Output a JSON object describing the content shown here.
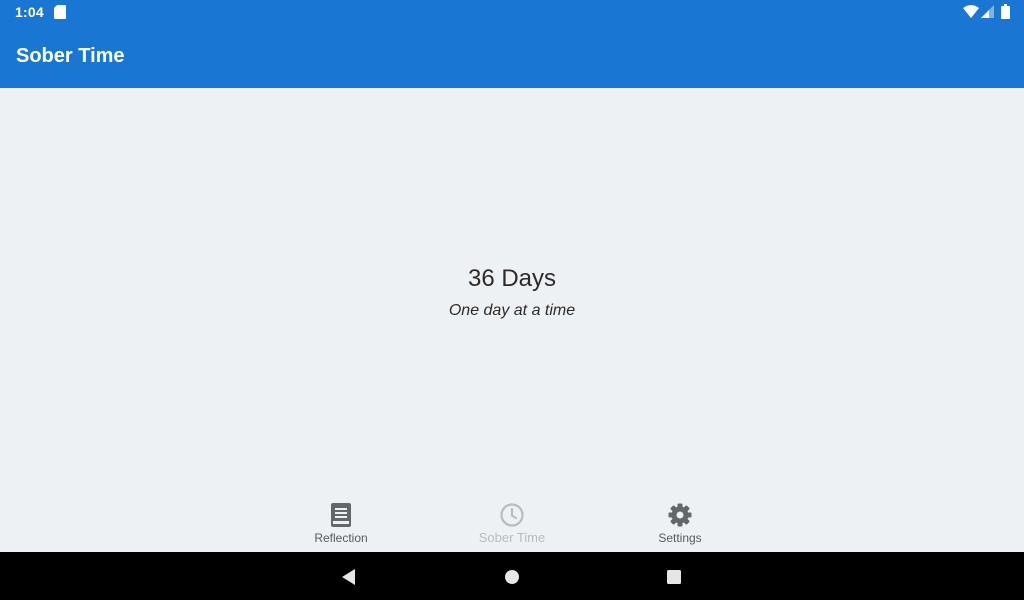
{
  "status_bar": {
    "time": "1:04",
    "icons": [
      "sd-card-icon",
      "wifi-icon",
      "signal-icon",
      "battery-icon"
    ]
  },
  "app_bar": {
    "title": "Sober Time",
    "color": "#1976d2"
  },
  "main": {
    "days_count": "36 Days",
    "tagline": "One day at a time"
  },
  "bottom_nav": {
    "items": [
      {
        "label": "Reflection",
        "icon": "book-icon",
        "active": false
      },
      {
        "label": "Sober Time",
        "icon": "clock-icon",
        "active": true
      },
      {
        "label": "Settings",
        "icon": "gear-icon",
        "active": false
      }
    ]
  },
  "system_nav": {
    "buttons": [
      "back-icon",
      "home-icon",
      "recents-icon"
    ]
  }
}
